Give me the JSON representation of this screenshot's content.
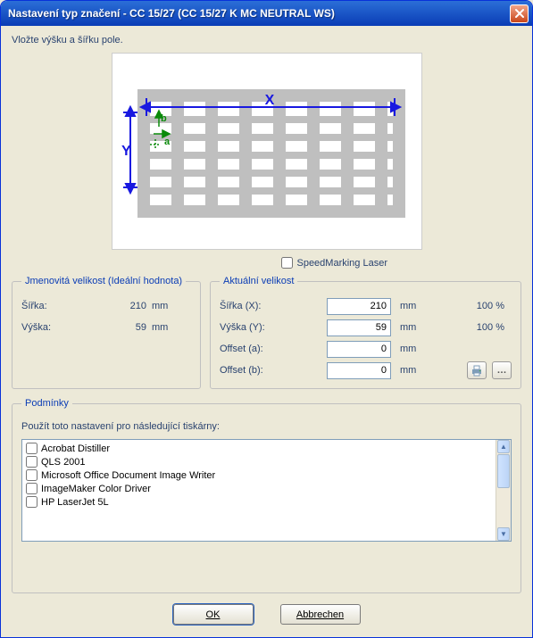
{
  "title": "Nastavení typ značení - CC 15/27 (CC 15/27 K MC NEUTRAL WS)",
  "instruction": "Vložte výšku a šířku pole.",
  "speedmarking_label": "SpeedMarking Laser",
  "nominal": {
    "legend": "Jmenovitá velikost (Ideální hodnota)",
    "width_label": "Šířka:",
    "width_value": "210",
    "height_label": "Výška:",
    "height_value": "59",
    "unit": "mm"
  },
  "actual": {
    "legend": "Aktuální velikost",
    "width_label": "Šířka (X):",
    "width_value": "210",
    "width_pct": "100 %",
    "height_label": "Výška (Y):",
    "height_value": "59",
    "height_pct": "100 %",
    "offset_a_label": "Offset (a):",
    "offset_a_value": "0",
    "offset_b_label": "Offset (b):",
    "offset_b_value": "0",
    "unit": "mm"
  },
  "conditions": {
    "legend": "Podmínky",
    "sublabel": "Použít toto nastavení pro následující tiskárny:",
    "printers": [
      "Acrobat Distiller",
      "QLS 2001",
      "Microsoft Office Document Image Writer",
      "ImageMaker Color Driver",
      "HP LaserJet 5L"
    ]
  },
  "buttons": {
    "ok": "OK",
    "cancel": "Abbrechen"
  },
  "diagram": {
    "x_label": "X",
    "y_label": "Y",
    "a_label": "a",
    "b_label": "b"
  }
}
